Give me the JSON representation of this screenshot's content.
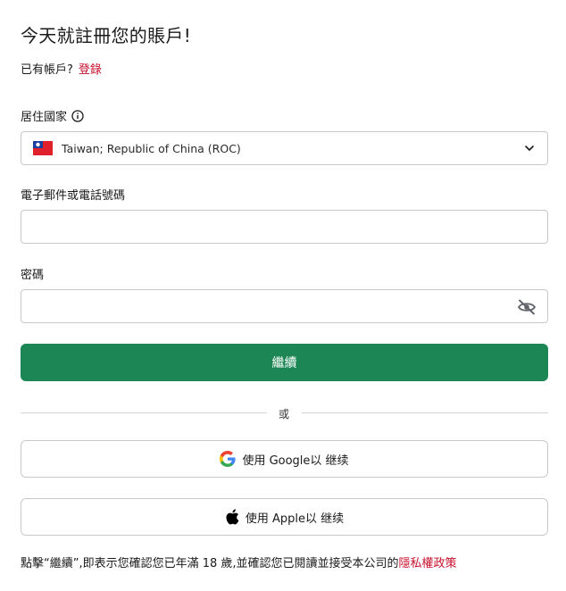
{
  "page": {
    "title": "今天就註冊您的賬戶!",
    "have_account": "已有帳戶?",
    "login_link": "登錄"
  },
  "colors": {
    "accent_green": "#1c8754",
    "link_red": "#c8102e",
    "border": "#c9c9c9"
  },
  "country": {
    "label": "居住國家",
    "info_icon": "info-icon",
    "flag_icon": "taiwan-flag-icon",
    "value": "Taiwan; Republic of China (ROC)"
  },
  "contact": {
    "label": "電子郵件或電話號碼",
    "value": "",
    "placeholder": ""
  },
  "password": {
    "label": "密碼",
    "value": "",
    "placeholder": "",
    "visibility_icon": "eye-slash-icon"
  },
  "continue_label": "繼續",
  "or_label": "或",
  "social": {
    "google_label": "使用 Google以 继续",
    "apple_label": "使用 Apple以 继续"
  },
  "terms": {
    "text": "點擊“繼續”,即表示您確認您已年滿 18 歲,並確認您已閱讀並接受本公司的",
    "privacy_link": "隱私權政策"
  }
}
